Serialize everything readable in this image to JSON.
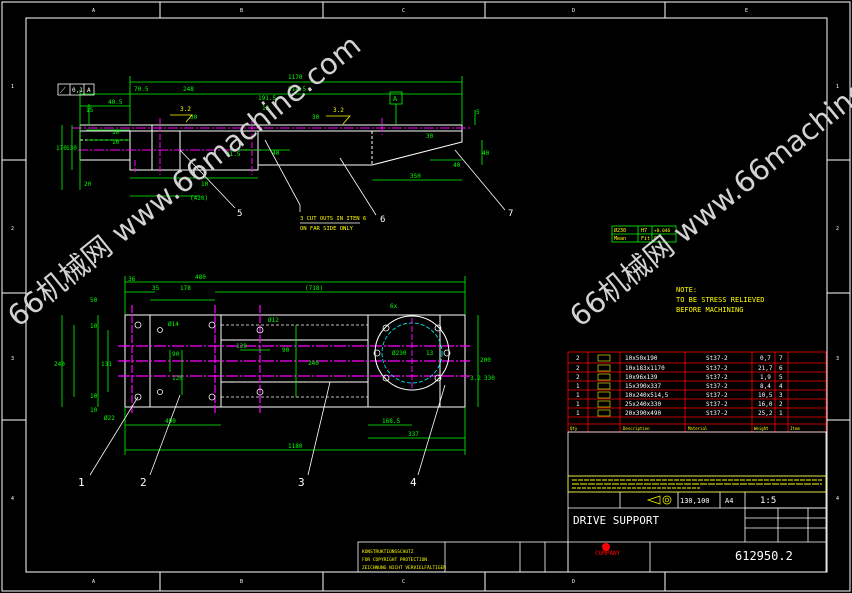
{
  "colors": {
    "background": "#000000",
    "frame": "#ffffff",
    "outline": "#ffffff",
    "dimension": "#00ff00",
    "centerline": "#ff00ff",
    "hidden": "#ffffff",
    "note": "#ffff00",
    "table_red": "#ff0000",
    "hole_circle": "#00ffff",
    "watermark": "#cfcfcf"
  },
  "frame": {
    "col_letters": [
      "A",
      "B",
      "C",
      "D",
      "E"
    ],
    "row_numbers": [
      "1",
      "2",
      "3",
      "4"
    ]
  },
  "top_view": {
    "dims": {
      "d1170": "1170",
      "d70_5": "70.5",
      "d248": "248",
      "d514_5": "514.5",
      "d40_5": "40.5",
      "d30a": "30",
      "d30b": "30",
      "d30c": "30",
      "d15": "15",
      "d10a": "10",
      "d10b": "10",
      "d170": "170",
      "d130": "130",
      "d20": "20",
      "d40a": "40",
      "d40b": "40",
      "d40c": "40",
      "d5": "5",
      "d10c": "10",
      "d420": "(420)",
      "d350": "350",
      "d31_5": "31.5",
      "d12": "12",
      "d191": "191.5"
    },
    "flatness": {
      "symbol": "⟋",
      "value": "0,1",
      "datum": "A"
    },
    "datum_box": "A",
    "weld_a": "3.2",
    "weld_b": "3.2",
    "cutout_note_line1": "3 CUT OUTS IN ITEN 6",
    "cutout_note_line2": "ON FAR SIDE ONLY",
    "balloons": [
      "5",
      "6",
      "7"
    ]
  },
  "plan_view": {
    "dims": {
      "d36": "36",
      "d480": "480",
      "d35": "35",
      "d178": "178",
      "d718": "(718)",
      "d50a": "50",
      "d10a": "10",
      "d10b": "10",
      "d240": "240",
      "d131": "131",
      "d90a": "90",
      "d120": "120",
      "d139": "139",
      "d90b": "90",
      "d240b": "240",
      "d200": "200",
      "d10c": "10",
      "d490": "490",
      "d1180": "1180",
      "d168": "168.5",
      "d337": "337",
      "d330": "330",
      "d14": "Ø14",
      "d22a": "Ø22",
      "d12": "Ø12",
      "d230": "Ø230",
      "d6x": "6x",
      "d32": "3.2",
      "d13": "13"
    },
    "balloons": [
      "1",
      "2",
      "3",
      "4"
    ]
  },
  "fit_table": {
    "row1": [
      "Ø230",
      "H7",
      "+0.046"
    ],
    "row2": [
      "Mean",
      "Fit",
      "0"
    ]
  },
  "note": {
    "title": "NOTE:",
    "line1": "TO BE STRESS RELIEVED",
    "line2": "BEFORE MACHINING"
  },
  "bom": {
    "rows": [
      {
        "qty": "2",
        "desc": "10x50x190",
        "mat": "St37-2",
        "kg": "0,7",
        "item": "7"
      },
      {
        "qty": "2",
        "desc": "10x183x1170",
        "mat": "St37-2",
        "kg": "21,7",
        "item": "6"
      },
      {
        "qty": "2",
        "desc": "10x96x139",
        "mat": "St37-2",
        "kg": "1,9",
        "item": "5"
      },
      {
        "qty": "1",
        "desc": "15x390x337",
        "mat": "St37-2",
        "kg": "8,4",
        "item": "4"
      },
      {
        "qty": "1",
        "desc": "10x240x514,5",
        "mat": "St37-2",
        "kg": "10,5",
        "item": "3"
      },
      {
        "qty": "1",
        "desc": "25x240x330",
        "mat": "St37-2",
        "kg": "16,0",
        "item": "2"
      },
      {
        "qty": "1",
        "desc": "20x390x490",
        "mat": "St37-2",
        "kg": "25,2",
        "item": "1"
      }
    ],
    "headers": [
      "Qty",
      "Description",
      "Material",
      "Weight",
      "Item"
    ]
  },
  "title_block": {
    "scale": "1:5",
    "sheet": "A4",
    "mass": "130,100",
    "title": "DRIVE SUPPORT",
    "drawing_no": "612950.2",
    "company": "COMPANY",
    "warning_l1": "KONSTRUKTIONSSCHUTZ",
    "warning_l2": "FOR COPYRIGHT PROTECTION",
    "warning_l3": "ZEICHNUNG NICHT VERVIELFÄLTIGEN"
  },
  "watermark": {
    "text": "66机械网 www.66machine.com"
  }
}
